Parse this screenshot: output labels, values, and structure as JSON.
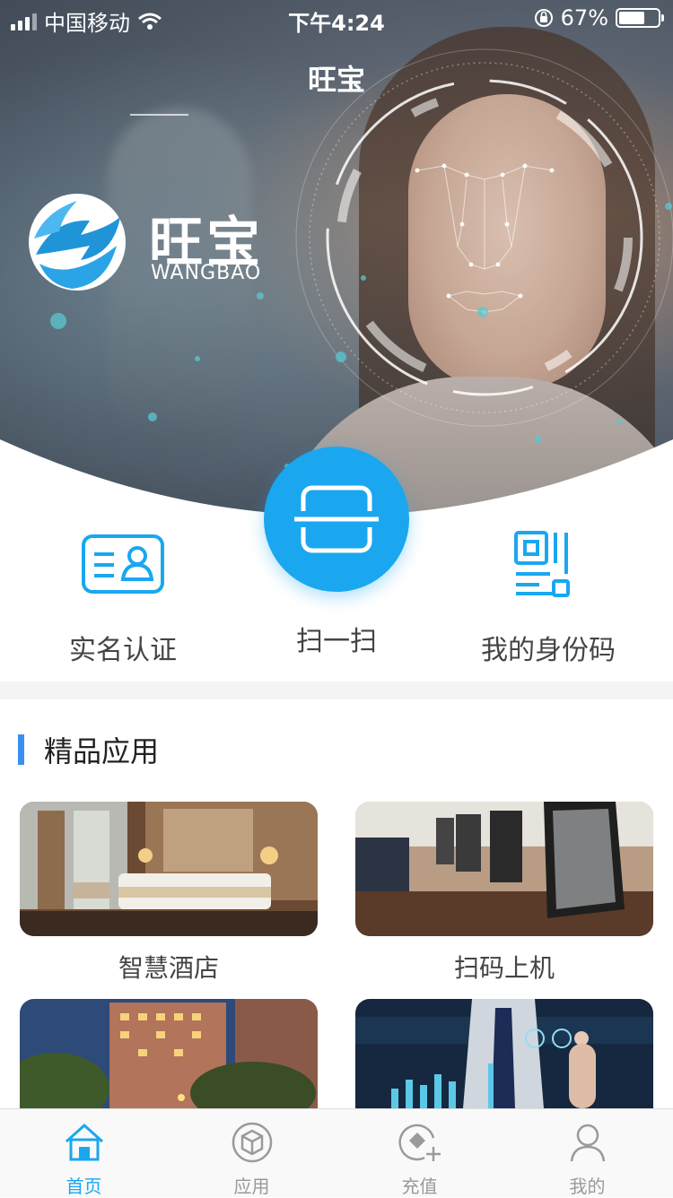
{
  "status_bar": {
    "carrier": "中国移动",
    "time": "下午4:24",
    "battery_percent": "67%",
    "battery_level": 0.67
  },
  "header": {
    "title": "旺宝"
  },
  "brand": {
    "name": "旺宝",
    "subtitle": "WANGBAO"
  },
  "quick_actions": {
    "realname": {
      "label": "实名认证",
      "icon": "id-card-icon"
    },
    "scan": {
      "label": "扫一扫",
      "icon": "scan-icon"
    },
    "idcode": {
      "label": "我的身份码",
      "icon": "qr-code-icon"
    }
  },
  "section": {
    "title": "精品应用"
  },
  "apps": [
    {
      "label": "智慧酒店"
    },
    {
      "label": "扫码上机"
    },
    {
      "label": ""
    },
    {
      "label": ""
    }
  ],
  "tabs": [
    {
      "label": "首页",
      "icon": "home-icon",
      "active": true
    },
    {
      "label": "应用",
      "icon": "cube-icon",
      "active": false
    },
    {
      "label": "充值",
      "icon": "recharge-icon",
      "active": false
    },
    {
      "label": "我的",
      "icon": "profile-icon",
      "active": false
    }
  ],
  "colors": {
    "accent": "#1aa7f0",
    "section_bar": "#3b8ff0",
    "tab_inactive": "#9a9a9a"
  }
}
